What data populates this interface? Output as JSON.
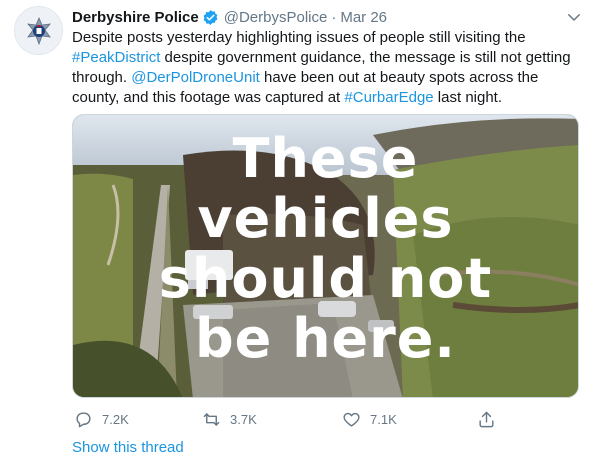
{
  "tweet": {
    "author_name": "Derbyshire Police",
    "handle": "@DerbysPolice",
    "separator": "·",
    "date": "Mar 26",
    "text_parts": {
      "p1": "Despite posts yesterday highlighting issues of people still visiting the ",
      "hashtag1": "#PeakDistrict",
      "p2": " despite government guidance, the message is still not getting through. ",
      "mention": "@DerPolDroneUnit",
      "p3": " have been out at beauty spots across the county, and this footage was captured at ",
      "hashtag2": "#CurbarEdge",
      "p4": " last night."
    },
    "media": {
      "caption_lines": [
        "These",
        "vehicles",
        "should not",
        "be here."
      ]
    },
    "actions": {
      "reply_count": "7.2K",
      "retweet_count": "3.7K",
      "like_count": "7.1K"
    },
    "show_thread": "Show this thread"
  },
  "icons": {
    "avatar": "police-badge-icon",
    "verified": "verified-badge-icon",
    "caret": "chevron-down-icon",
    "reply": "reply-icon",
    "retweet": "retweet-icon",
    "like": "heart-icon",
    "share": "share-icon"
  },
  "colors": {
    "link": "#1b95e0",
    "secondary_text": "#657786",
    "verified": "#1da1f2"
  }
}
